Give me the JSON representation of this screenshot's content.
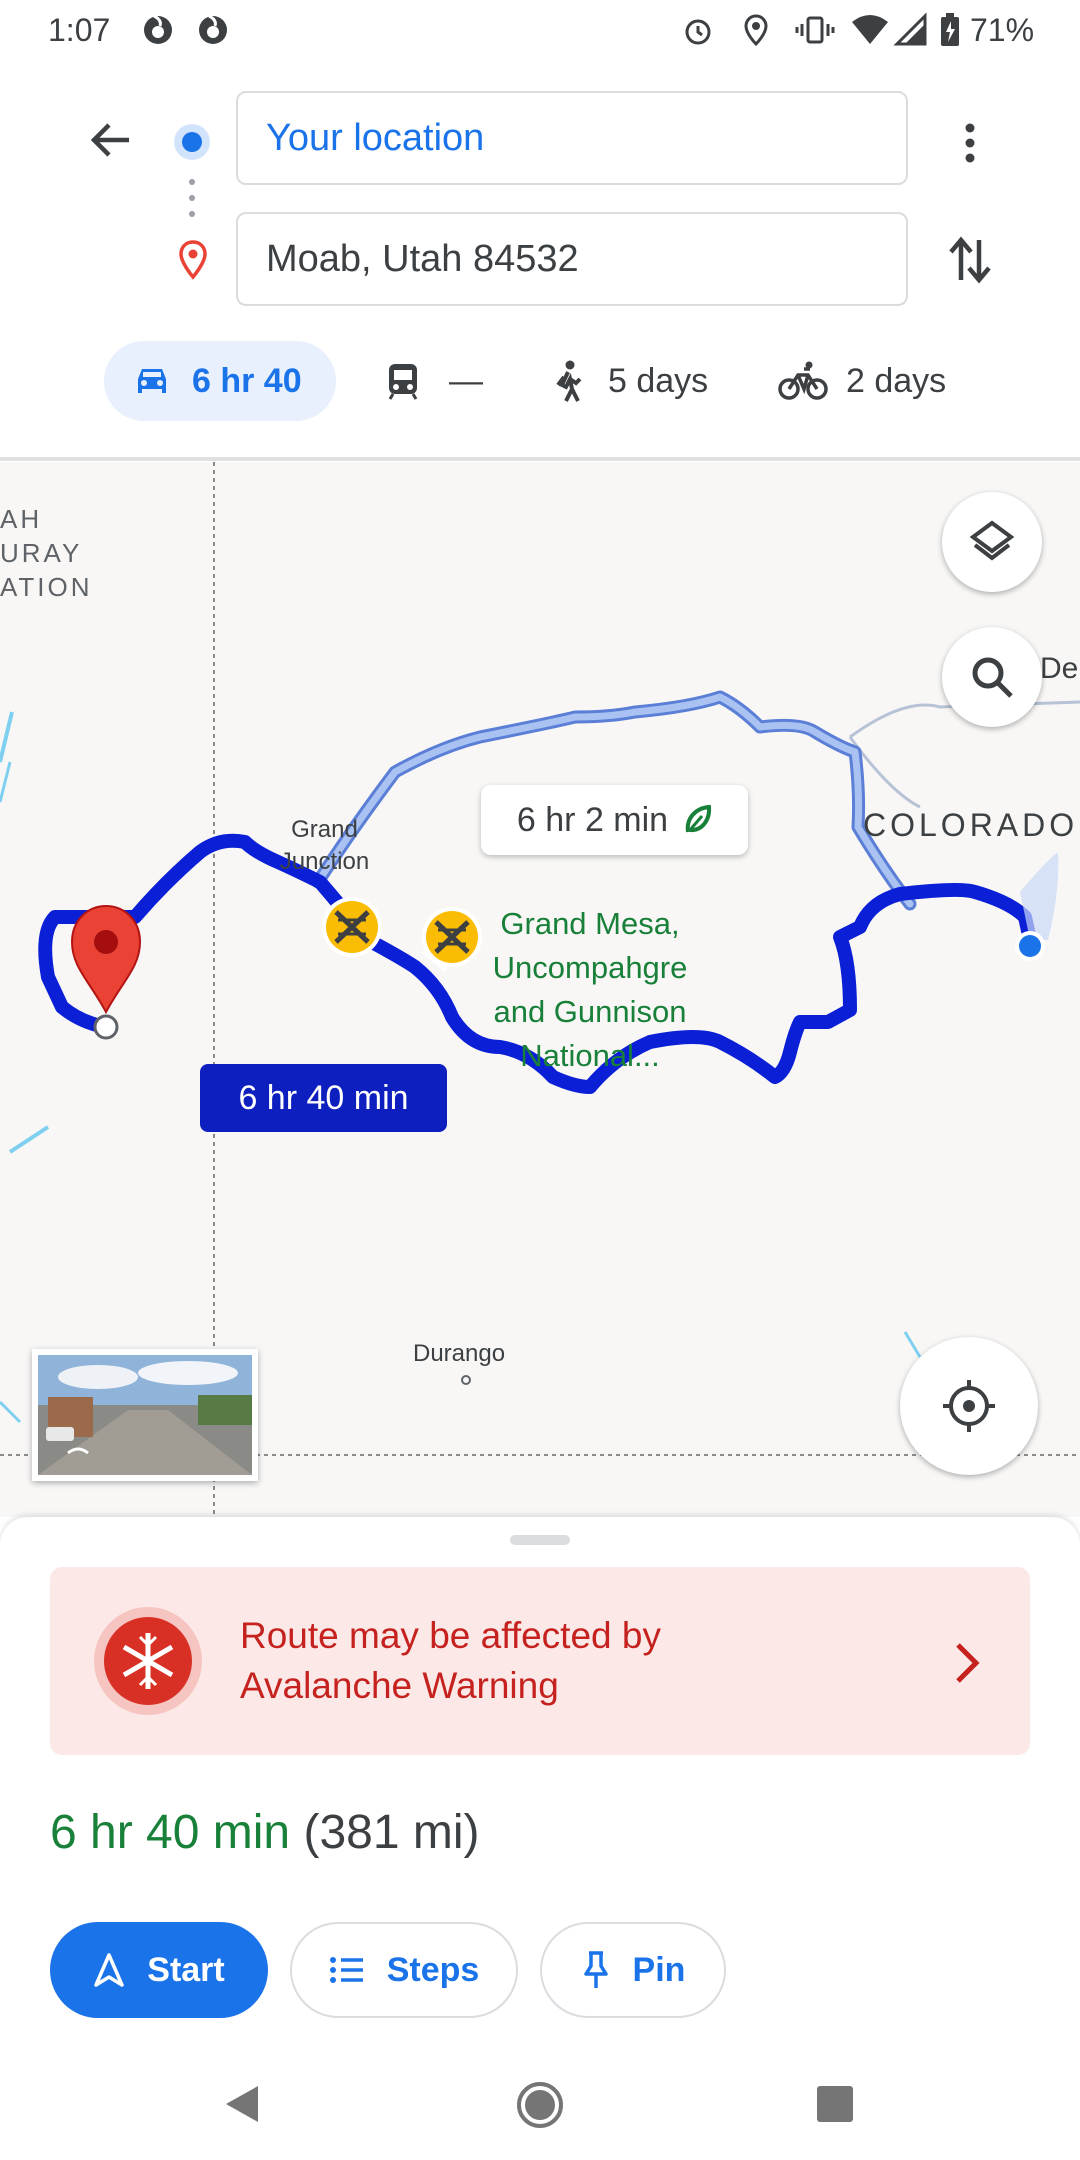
{
  "status_bar": {
    "time": "1:07",
    "battery": "71%",
    "icons": [
      "firefox-icon",
      "firefox-icon",
      "alarm-icon",
      "location-icon",
      "vibrate-icon",
      "wifi-icon",
      "signal-icon",
      "battery-charging-icon"
    ]
  },
  "directions": {
    "origin": "Your location",
    "destination": "Moab, Utah 84532",
    "modes": [
      {
        "icon": "car-icon",
        "label": "6 hr 40",
        "selected": true
      },
      {
        "icon": "transit-icon",
        "label": "—"
      },
      {
        "icon": "walk-icon",
        "label": "5 days"
      },
      {
        "icon": "bike-icon",
        "label": "2 days"
      }
    ]
  },
  "map": {
    "labels": {
      "reservation": "AH\nURAY\nATION",
      "grand_junction": "Grand\nJunction",
      "colorado": "COLORADO",
      "denver_partial": "Der",
      "forest": "Grand Mesa,\nUncompahgre\nand Gunnison\nNational...",
      "durango": "Durango"
    },
    "alt_route_label": "6 hr 2 min",
    "main_route_label": "6 hr 40 min",
    "colors": {
      "route": "#1a1aff",
      "alt_route": "#8ab4f8",
      "forest_text": "#188038",
      "primary_label_bg": "#0d1fbf"
    }
  },
  "sheet": {
    "alert": "Route may be affected by\nAvalanche Warning",
    "summary_time": "6 hr 40 min",
    "summary_distance": "(381 mi)",
    "buttons": {
      "start": "Start",
      "steps": "Steps",
      "pin": "Pin"
    }
  }
}
